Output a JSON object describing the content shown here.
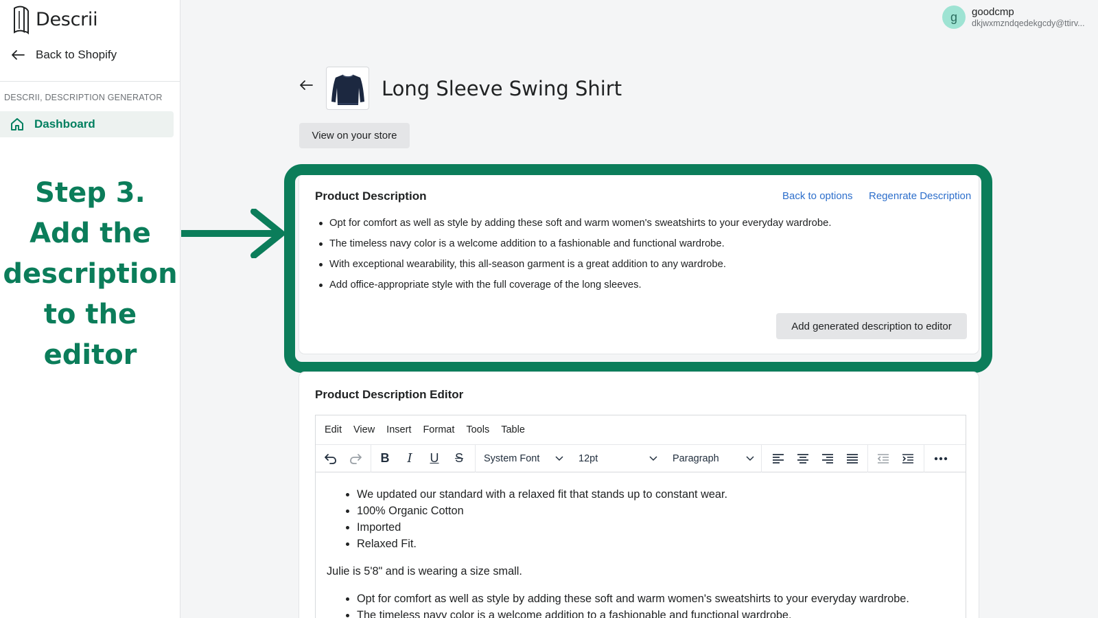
{
  "sidebar": {
    "brand": "Descrii",
    "back_label": "Back to Shopify",
    "section_label": "DESCRII, DESCRIPTION GENERATOR",
    "nav_item": "Dashboard"
  },
  "annotation": {
    "lines": [
      "Step 3.",
      "Add the",
      "description",
      "to the",
      "editor"
    ]
  },
  "user": {
    "initial": "g",
    "name": "goodcmp",
    "email": "dkjwxmzndqedekgcdy@ttirv..."
  },
  "page": {
    "title": "Long Sleeve Swing Shirt",
    "view_store_label": "View on your store"
  },
  "generated": {
    "title": "Product Description",
    "back_to_options": "Back to options",
    "regenerate": "Regenrate Description",
    "bullets": [
      "Opt for comfort as well as style by adding these soft and warm women's sweatshirts to your everyday wardrobe.",
      "The timeless navy color is a welcome addition to a fashionable and functional wardrobe.",
      "With exceptional wearability, this all-season garment is a great addition to any wardrobe.",
      "Add office-appropriate style with the full coverage of the long sleeves."
    ],
    "add_button": "Add generated description to editor"
  },
  "editor": {
    "title": "Product Description Editor",
    "menu": [
      "Edit",
      "View",
      "Insert",
      "Format",
      "Tools",
      "Table"
    ],
    "font_family": "System Font",
    "font_size": "12pt",
    "block_format": "Paragraph",
    "content": {
      "list1": [
        "We updated our standard with a relaxed fit that stands up to constant wear.",
        "100% Organic Cotton",
        "Imported",
        "Relaxed Fit."
      ],
      "paragraph": "Julie is 5'8\" and is wearing a size small.",
      "list2": [
        "Opt for comfort as well as style by adding these soft and warm women's sweatshirts to your everyday wardrobe.",
        "The timeless navy color is a welcome addition to a fashionable and functional wardrobe."
      ]
    }
  },
  "colors": {
    "accent": "#0b7d5a",
    "link": "#2c6ecb",
    "nav_active_bg": "#edf2f0"
  }
}
